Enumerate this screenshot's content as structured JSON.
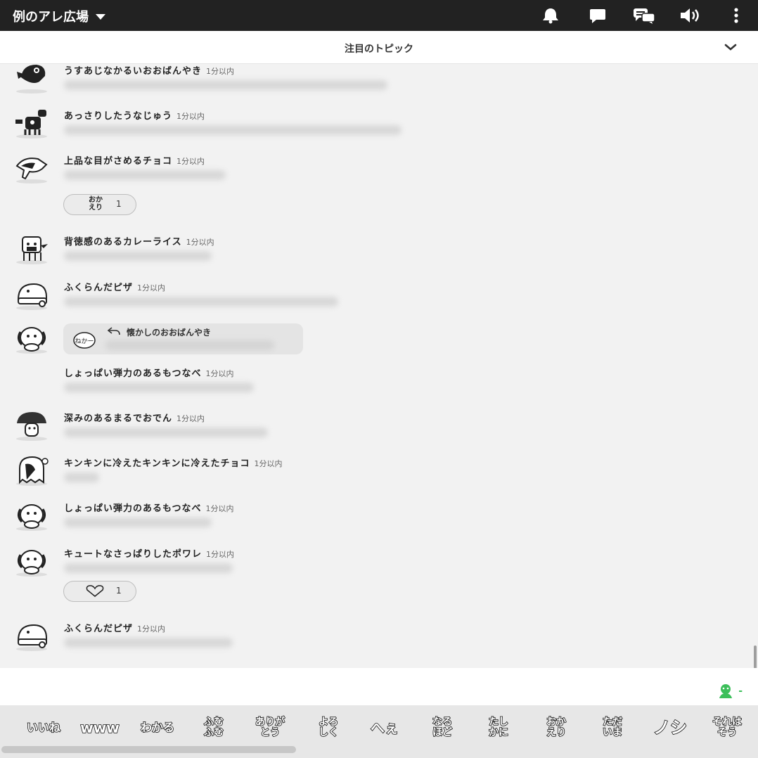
{
  "header": {
    "room_title": "例のアレ広場"
  },
  "topic_bar": {
    "label": "注目のトピック"
  },
  "messages": [
    {
      "name": "うすあじなかるいおおばんやき",
      "time": "1分以内"
    },
    {
      "name": "あっさりしたうなじゅう",
      "time": "1分以内"
    },
    {
      "name": "上品な目がさめるチョコ",
      "time": "1分以内"
    },
    {
      "name": "背徳感のあるカレーライス",
      "time": "1分以内"
    },
    {
      "name": "ふくらんだピザ",
      "time": "1分以内"
    },
    {
      "name": "しょっぱい弾力のあるもつなべ",
      "time": "1分以内"
    },
    {
      "name": "深みのあるまるでおでん",
      "time": "1分以内"
    },
    {
      "name": "キンキンに冷えたキンキンに冷えたチョコ",
      "time": "1分以内"
    },
    {
      "name": "しょっぱい弾力のあるもつなべ",
      "time": "1分以内"
    },
    {
      "name": "キュートなさっぱりしたポワレ",
      "time": "1分以内"
    },
    {
      "name": "ふくらんだピザ",
      "time": "1分以内"
    }
  ],
  "reactions": {
    "okaeri": {
      "label": "おか えり",
      "count": "1"
    },
    "heart": {
      "icon": "heart-icon",
      "count": "1"
    }
  },
  "reply": {
    "name": "懐かしのおおばんやき",
    "avatar_text": "ねかー"
  },
  "presence": {
    "count": "-",
    "color": "#3cbf5a"
  },
  "stamps": [
    "いいね",
    "www",
    "わかる",
    "ふむ ふむ",
    "ありが とう",
    "よろ しく",
    "へぇ",
    "なる ほど",
    "たし かに",
    "おか えり",
    "ただ いま",
    "ノシ",
    "それは そう"
  ],
  "colors": {
    "header_bg": "#222222",
    "background": "#f2f2f2",
    "accent": "#3cbf5a"
  }
}
